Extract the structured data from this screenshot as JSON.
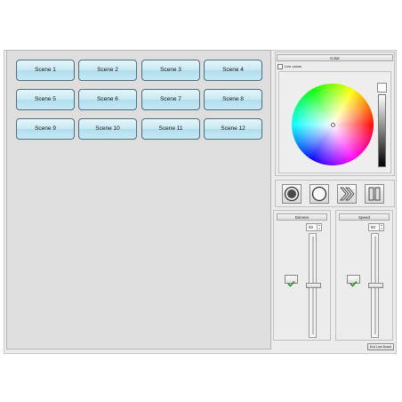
{
  "scenes": [
    "Scene 1",
    "Scene 2",
    "Scene 3",
    "Scene 4",
    "Scene 5",
    "Scene 6",
    "Scene 7",
    "Scene 8",
    "Scene 9",
    "Scene 10",
    "Scene 11",
    "Scene 12"
  ],
  "color_panel": {
    "title": "Color",
    "live_colors_label": "Live colors",
    "live_colors_checked": false,
    "selected_color": "#ffffff"
  },
  "transport": {
    "buttons": [
      "record-icon",
      "circle-icon",
      "fast-forward-icon",
      "pause-icon"
    ],
    "active": "record-icon"
  },
  "dimmer": {
    "title": "Dimmer",
    "value": "50",
    "level": 0.5,
    "enabled": true
  },
  "speed": {
    "title": "Speed",
    "value": "50",
    "level": 0.5,
    "enabled": true
  },
  "exit_button": "Exit Live Board",
  "colors": {
    "scene_button": "#c6e8f3",
    "panel": "#dedede"
  }
}
